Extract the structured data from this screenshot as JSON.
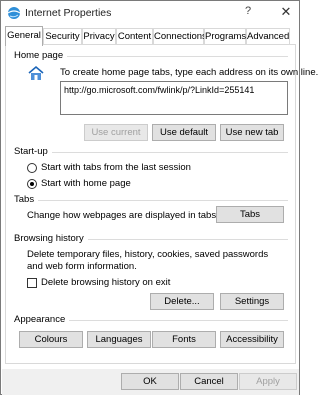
{
  "window": {
    "title": "Internet Properties",
    "help": "?",
    "close": "✕"
  },
  "tabs": [
    {
      "label": "General",
      "active": true
    },
    {
      "label": "Security"
    },
    {
      "label": "Privacy"
    },
    {
      "label": "Content"
    },
    {
      "label": "Connections"
    },
    {
      "label": "Programs"
    },
    {
      "label": "Advanced"
    }
  ],
  "homepage": {
    "group": "Home page",
    "instruction": "To create home page tabs, type each address on its own line.",
    "url": "http://go.microsoft.com/fwlink/p/?LinkId=255141",
    "use_current": "Use current",
    "use_default": "Use default",
    "use_new_tab": "Use new tab"
  },
  "startup": {
    "group": "Start-up",
    "option_last_session": "Start with tabs from the last session",
    "option_home_page": "Start with home page",
    "selected": "home_page"
  },
  "tabs_section": {
    "group": "Tabs",
    "description": "Change how webpages are displayed in tabs.",
    "button": "Tabs"
  },
  "history": {
    "group": "Browsing history",
    "description": "Delete temporary files, history, cookies, saved passwords and web form information.",
    "checkbox_label": "Delete browsing history on exit",
    "checked": false,
    "delete_button": "Delete...",
    "settings_button": "Settings"
  },
  "appearance": {
    "group": "Appearance",
    "colours": "Colours",
    "languages": "Languages",
    "fonts": "Fonts",
    "accessibility": "Accessibility"
  },
  "footer": {
    "ok": "OK",
    "cancel": "Cancel",
    "apply": "Apply"
  }
}
